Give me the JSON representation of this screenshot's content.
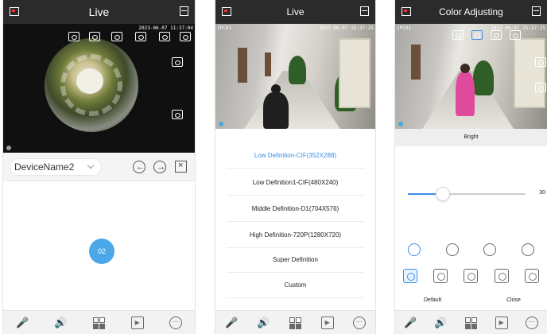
{
  "screen1": {
    "title": "Live",
    "osd_time": "2023-06-07 11:37:04",
    "device_name": "DeviceName2",
    "nav_prev": "←",
    "nav_next": "→",
    "close": "×",
    "channel_badge": "02",
    "bottom_icons": [
      "microphone-icon",
      "speaker-icon",
      "grid-icon",
      "playback-icon",
      "more-icon"
    ]
  },
  "screen2": {
    "title": "Live",
    "osd_channel": "IPC01",
    "osd_time": "2023-06-07 15:37:25",
    "resolutions": [
      "Low Definition-CIF(352X288)",
      "Low Definition1-CIF(480X240)",
      "Middle Definition-D1(704X576)",
      "High Definition-720P(1280X720)",
      "Super Definition",
      "Custom"
    ],
    "selected_index": 0,
    "accent": "#3a8ee6"
  },
  "screen3": {
    "title": "Color Adjusting",
    "osd_channel": "IPC01",
    "osd_time": "2023-06-07 15:37:25",
    "slider_label": "Bright",
    "slider_value": "30",
    "slider_fraction": 0.3,
    "default_label": "Default",
    "close_label": "Close"
  }
}
